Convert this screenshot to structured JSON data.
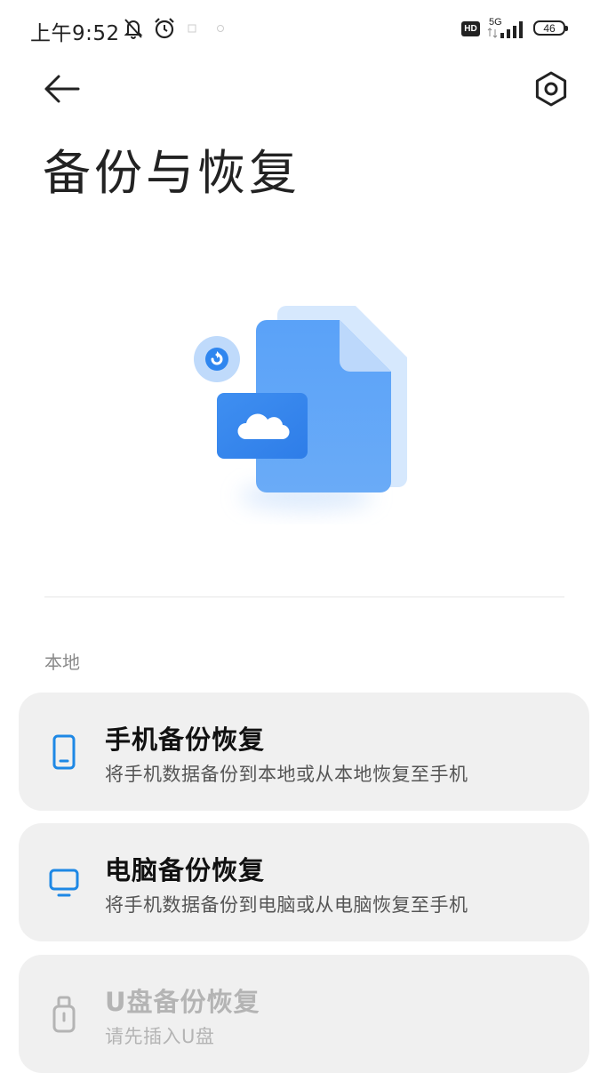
{
  "status_bar": {
    "time": "上午9:52",
    "hd_label": "HD",
    "network_label": "5G",
    "battery": "46"
  },
  "header": {
    "title": "备份与恢复"
  },
  "section": {
    "label": "本地"
  },
  "options": [
    {
      "title": "手机备份恢复",
      "subtitle": "将手机数据备份到本地或从本地恢复至手机",
      "icon": "phone-icon",
      "enabled": true
    },
    {
      "title": "电脑备份恢复",
      "subtitle": "将手机数据备份到电脑或从电脑恢复至手机",
      "icon": "monitor-icon",
      "enabled": true
    },
    {
      "title": "U盘备份恢复",
      "subtitle": "请先插入U盘",
      "icon": "usb-drive-icon",
      "enabled": false
    }
  ],
  "colors": {
    "accent": "#1e88e5",
    "disabled": "#b4b4b4",
    "card_bg": "#f0f0f0"
  }
}
